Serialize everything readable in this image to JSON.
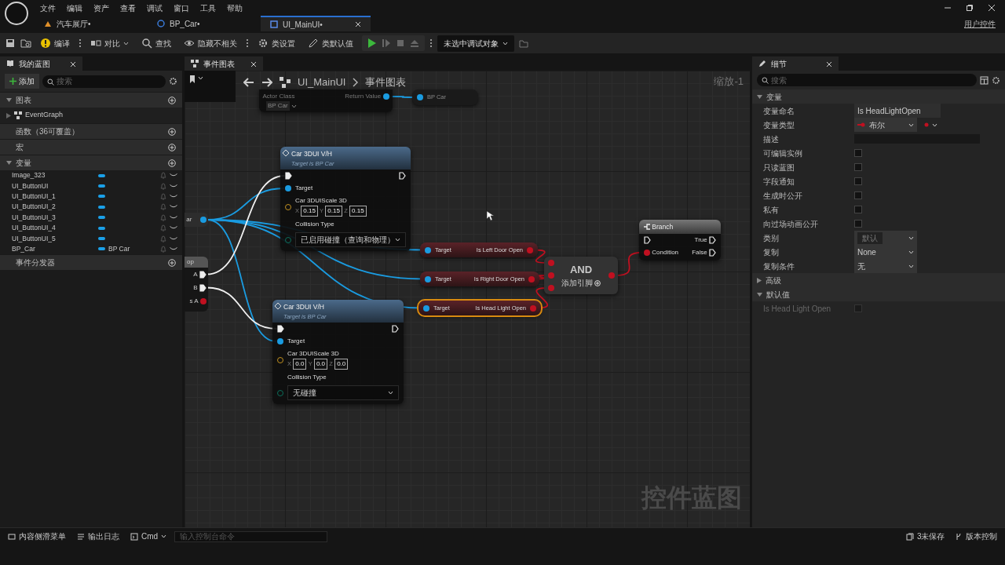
{
  "window": {
    "menu": [
      "文件",
      "编辑",
      "资产",
      "查看",
      "调试",
      "窗口",
      "工具",
      "帮助"
    ],
    "document_tabs": [
      {
        "label": "汽车展厅•",
        "kind": "level",
        "selected": false
      },
      {
        "label": "BP_Car•",
        "kind": "blueprint",
        "selected": false
      },
      {
        "label": "UI_MainUI•",
        "kind": "widget",
        "selected": true
      }
    ],
    "parent_class": "用户控件"
  },
  "toolbar": {
    "items": [
      {
        "kind": "compile",
        "label": "编译"
      },
      {
        "kind": "diff",
        "label": "对比"
      },
      {
        "kind": "find",
        "label": "查找"
      },
      {
        "kind": "hide",
        "label": "隐藏不相关"
      },
      {
        "kind": "settings",
        "label": "类设置"
      },
      {
        "kind": "defaults",
        "label": "类默认值"
      }
    ],
    "debug_object": "未选中调试对象"
  },
  "my_blueprint": {
    "tab": "我的蓝图",
    "add_label": "添加",
    "search_placeholder": "搜索",
    "sections": [
      {
        "title": "图表",
        "expanded": true,
        "items": [
          {
            "label": "EventGraph"
          }
        ]
      },
      {
        "title": "函数（36可覆盖）",
        "expanded": false
      },
      {
        "title": "宏",
        "expanded": false
      },
      {
        "title": "变量",
        "expanded": true,
        "variables": [
          {
            "name": "Image_323"
          },
          {
            "name": "UI_ButtonUI"
          },
          {
            "name": "UI_ButtonUI_1"
          },
          {
            "name": "UI_ButtonUI_2"
          },
          {
            "name": "UI_ButtonUI_3"
          },
          {
            "name": "UI_ButtonUI_4"
          },
          {
            "name": "UI_ButtonUI_5"
          },
          {
            "name": "BP_Car",
            "type_label": "BP Car"
          }
        ]
      },
      {
        "title": "事件分发器",
        "expanded": false
      }
    ]
  },
  "graph": {
    "tab": "事件图表",
    "breadcrumb": [
      "UI_MainUI",
      "事件图表"
    ],
    "zoom": "缩放-1",
    "graph_type": "控件蓝图",
    "nodes": [
      {
        "kind": "spawn",
        "input_label": "Actor Class",
        "class_value": "BP Car",
        "output_label": "Return Value"
      },
      {
        "kind": "var_get",
        "label": "BP Car"
      },
      {
        "kind": "stub",
        "label": "ar"
      },
      {
        "kind": "stub_exec",
        "title": "op",
        "pins": [
          "A",
          "B",
          "s A"
        ]
      },
      {
        "kind": "call",
        "title": "Car 3DUI V/H",
        "subtitle": "Target is BP Car",
        "target_label": "Target",
        "vector_label": "Car 3DUIScale 3D",
        "vector": [
          {
            "axis": "X",
            "value": "0.15"
          },
          {
            "axis": "Y",
            "value": "0.15"
          },
          {
            "axis": "Z",
            "value": "0.15"
          }
        ],
        "enum_label": "Collision Type",
        "enum_value": "已启用碰撞（查询和物理）"
      },
      {
        "kind": "call",
        "title": "Car 3DUI V/H",
        "subtitle": "Target is BP Car",
        "target_label": "Target",
        "vector_label": "Car 3DUIScale 3D",
        "vector": [
          {
            "axis": "X",
            "value": "0.0"
          },
          {
            "axis": "Y",
            "value": "0.0"
          },
          {
            "axis": "Z",
            "value": "0.0"
          }
        ],
        "enum_label": "Collision Type",
        "enum_value": "无碰撞"
      },
      {
        "kind": "getter",
        "target_label": "Target",
        "label": "Is Left Door Open",
        "selected": false
      },
      {
        "kind": "getter",
        "target_label": "Target",
        "label": "Is Right Door Open",
        "selected": false
      },
      {
        "kind": "getter",
        "target_label": "Target",
        "label": "Is Head Light Open",
        "selected": true
      },
      {
        "kind": "and",
        "title": "AND",
        "add_pin": "添加引脚"
      },
      {
        "kind": "branch",
        "title": "Branch",
        "true_label": "True",
        "condition": "Condition",
        "false_label": "False"
      }
    ]
  },
  "details": {
    "tab": "细节",
    "search_placeholder": "搜索",
    "sections": [
      {
        "title": "变量",
        "expanded": true,
        "properties": [
          {
            "kind": "text",
            "label": "变量命名",
            "value": "Is HeadLightOpen"
          },
          {
            "kind": "type",
            "label": "变量类型",
            "value": "布尔"
          },
          {
            "kind": "textarea",
            "label": "描述"
          },
          {
            "kind": "check",
            "label": "可编辑实例",
            "checked": false,
            "disabled": false
          },
          {
            "kind": "check",
            "label": "只读蓝图",
            "checked": false,
            "disabled": false
          },
          {
            "kind": "check",
            "label": "字段通知",
            "checked": false,
            "disabled": false
          },
          {
            "kind": "check",
            "label": "生成时公开",
            "checked": false,
            "disabled": false
          },
          {
            "kind": "check",
            "label": "私有",
            "checked": false,
            "disabled": false
          },
          {
            "kind": "check",
            "label": "向过场动画公开",
            "checked": false,
            "disabled": false
          },
          {
            "kind": "combo",
            "label": "类别",
            "value": "默认"
          },
          {
            "kind": "select",
            "label": "复制",
            "value": "None"
          },
          {
            "kind": "select",
            "label": "复制条件",
            "value": "无"
          }
        ]
      },
      {
        "title": "高级",
        "expanded": false
      },
      {
        "title": "默认值",
        "expanded": true,
        "properties": [
          {
            "kind": "check",
            "label": "Is Head Light Open",
            "checked": false,
            "disabled": true
          }
        ]
      }
    ]
  },
  "status_bar": {
    "left": [
      {
        "kind": "drawer",
        "label": "内容侧滑菜单"
      },
      {
        "kind": "log",
        "label": "输出日志"
      },
      {
        "kind": "cmd",
        "label": "Cmd"
      }
    ],
    "console_placeholder": "输入控制台命令",
    "right": [
      {
        "kind": "unsaved",
        "label": "3未保存"
      },
      {
        "kind": "vcs",
        "label": "版本控制"
      }
    ]
  }
}
